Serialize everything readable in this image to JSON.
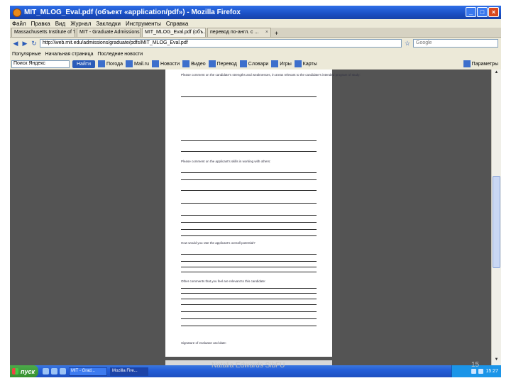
{
  "window": {
    "title": "MIT_MLOG_Eval.pdf (объект «application/pdf») - Mozilla Firefox",
    "buttons": {
      "minimize": "_",
      "maximize": "□",
      "close": "×"
    }
  },
  "menu": [
    "Файл",
    "Правка",
    "Вид",
    "Журнал",
    "Закладки",
    "Инструменты",
    "Справка"
  ],
  "tabs": [
    {
      "label": "Massachusetts Institute of T...",
      "active": false
    },
    {
      "label": "MIT - Graduate Admissions",
      "active": false
    },
    {
      "label": "MIT_MLOG_Eval.pdf (объ...",
      "active": true
    },
    {
      "label": "перевод по-англ. с ...",
      "active": false
    }
  ],
  "nav": {
    "url": "http://web.mit.edu/admissions/graduate/pdfs/MIT_MLOG_Eval.pdf",
    "search_placeholder": "Google"
  },
  "bookmarks": [
    "Популярные",
    "Начальная страница",
    "Последние новости"
  ],
  "toolbar": {
    "search_value": "Поиск Яндекс",
    "search_button": "Найти",
    "items": [
      "Погода",
      "Mail.ru",
      "Новости",
      "Видео",
      "Перевод",
      "Словари",
      "Игры",
      "Карты"
    ],
    "right_label": "Параметры"
  },
  "document": {
    "questions": [
      "Please comment on the candidate's strengths and weaknesses, in areas relevant to the candidate's intended program of study:",
      "Please comment on the applicant's skills in working with others:",
      "How would you rate the applicant's overall potential?",
      "Other comments that you feel are relevant to this candidate:",
      "Signature of evaluator and date:"
    ]
  },
  "taskbar": {
    "start_label": "пуск",
    "tasks": [
      "MIT - Grad...",
      "Mozilla Fire..."
    ],
    "clock": "15:27"
  },
  "slide_footer": {
    "author": "Natalia Edwards SibFU",
    "page_number": "15"
  }
}
